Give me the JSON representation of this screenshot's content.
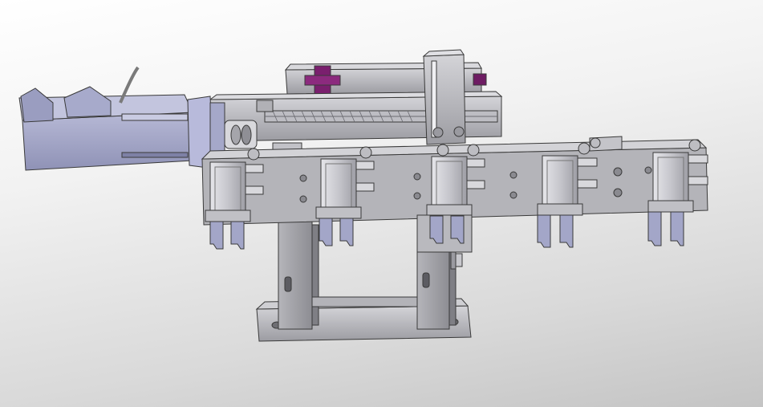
{
  "scene": {
    "subject": "cad-assembly-linear-module-with-five-pneumatic-grippers",
    "gripper_count": 5,
    "text_labels": []
  },
  "colors": {
    "background_top": "#ffffff",
    "background_bottom": "#c4c4c4",
    "metal_light": "#c9c9cd",
    "metal_mid": "#a9a9ae",
    "metal_dark": "#8a8a90",
    "motor_body": "#a9abc9",
    "motor_dark": "#8c8fb2",
    "accent_purple": "#7a1f6e",
    "edge": "#3a3a3a"
  }
}
